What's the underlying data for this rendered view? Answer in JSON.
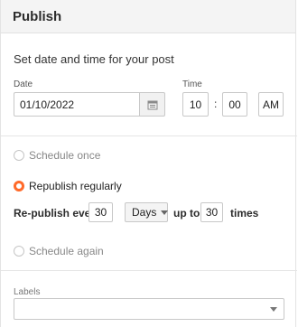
{
  "header": {
    "title": "Publish"
  },
  "datetime": {
    "subtitle": "Set date and time for your post",
    "date_label": "Date",
    "date_value": "01/10/2022",
    "time_label": "Time",
    "hour": "10",
    "separator": ":",
    "minute": "00",
    "ampm": "AM"
  },
  "options": {
    "schedule_once": "Schedule once",
    "republish_regularly": "Republish regularly",
    "schedule_again": "Schedule again",
    "selected": "republish_regularly"
  },
  "republish": {
    "prefix": "Re-publish every",
    "interval": "30",
    "unit": "Days",
    "up_to": "up to",
    "times_count": "30",
    "suffix": "times"
  },
  "labels": {
    "label": "Labels",
    "value": ""
  },
  "colors": {
    "accent": "#ff6a2a",
    "header_bg": "#f4f4f4"
  }
}
